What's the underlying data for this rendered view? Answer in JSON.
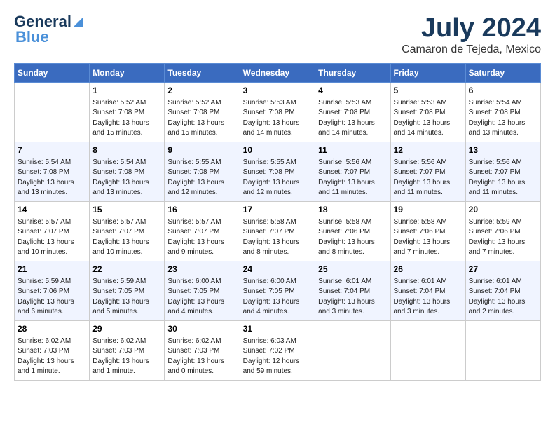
{
  "header": {
    "logo_line1": "General",
    "logo_line2": "Blue",
    "month_year": "July 2024",
    "location": "Camaron de Tejeda, Mexico"
  },
  "days_of_week": [
    "Sunday",
    "Monday",
    "Tuesday",
    "Wednesday",
    "Thursday",
    "Friday",
    "Saturday"
  ],
  "weeks": [
    [
      {
        "day": "",
        "sunrise": "",
        "sunset": "",
        "daylight": ""
      },
      {
        "day": "1",
        "sunrise": "Sunrise: 5:52 AM",
        "sunset": "Sunset: 7:08 PM",
        "daylight": "Daylight: 13 hours and 15 minutes."
      },
      {
        "day": "2",
        "sunrise": "Sunrise: 5:52 AM",
        "sunset": "Sunset: 7:08 PM",
        "daylight": "Daylight: 13 hours and 15 minutes."
      },
      {
        "day": "3",
        "sunrise": "Sunrise: 5:53 AM",
        "sunset": "Sunset: 7:08 PM",
        "daylight": "Daylight: 13 hours and 14 minutes."
      },
      {
        "day": "4",
        "sunrise": "Sunrise: 5:53 AM",
        "sunset": "Sunset: 7:08 PM",
        "daylight": "Daylight: 13 hours and 14 minutes."
      },
      {
        "day": "5",
        "sunrise": "Sunrise: 5:53 AM",
        "sunset": "Sunset: 7:08 PM",
        "daylight": "Daylight: 13 hours and 14 minutes."
      },
      {
        "day": "6",
        "sunrise": "Sunrise: 5:54 AM",
        "sunset": "Sunset: 7:08 PM",
        "daylight": "Daylight: 13 hours and 13 minutes."
      }
    ],
    [
      {
        "day": "7",
        "sunrise": "Sunrise: 5:54 AM",
        "sunset": "Sunset: 7:08 PM",
        "daylight": "Daylight: 13 hours and 13 minutes."
      },
      {
        "day": "8",
        "sunrise": "Sunrise: 5:54 AM",
        "sunset": "Sunset: 7:08 PM",
        "daylight": "Daylight: 13 hours and 13 minutes."
      },
      {
        "day": "9",
        "sunrise": "Sunrise: 5:55 AM",
        "sunset": "Sunset: 7:08 PM",
        "daylight": "Daylight: 13 hours and 12 minutes."
      },
      {
        "day": "10",
        "sunrise": "Sunrise: 5:55 AM",
        "sunset": "Sunset: 7:08 PM",
        "daylight": "Daylight: 13 hours and 12 minutes."
      },
      {
        "day": "11",
        "sunrise": "Sunrise: 5:56 AM",
        "sunset": "Sunset: 7:07 PM",
        "daylight": "Daylight: 13 hours and 11 minutes."
      },
      {
        "day": "12",
        "sunrise": "Sunrise: 5:56 AM",
        "sunset": "Sunset: 7:07 PM",
        "daylight": "Daylight: 13 hours and 11 minutes."
      },
      {
        "day": "13",
        "sunrise": "Sunrise: 5:56 AM",
        "sunset": "Sunset: 7:07 PM",
        "daylight": "Daylight: 13 hours and 11 minutes."
      }
    ],
    [
      {
        "day": "14",
        "sunrise": "Sunrise: 5:57 AM",
        "sunset": "Sunset: 7:07 PM",
        "daylight": "Daylight: 13 hours and 10 minutes."
      },
      {
        "day": "15",
        "sunrise": "Sunrise: 5:57 AM",
        "sunset": "Sunset: 7:07 PM",
        "daylight": "Daylight: 13 hours and 10 minutes."
      },
      {
        "day": "16",
        "sunrise": "Sunrise: 5:57 AM",
        "sunset": "Sunset: 7:07 PM",
        "daylight": "Daylight: 13 hours and 9 minutes."
      },
      {
        "day": "17",
        "sunrise": "Sunrise: 5:58 AM",
        "sunset": "Sunset: 7:07 PM",
        "daylight": "Daylight: 13 hours and 8 minutes."
      },
      {
        "day": "18",
        "sunrise": "Sunrise: 5:58 AM",
        "sunset": "Sunset: 7:06 PM",
        "daylight": "Daylight: 13 hours and 8 minutes."
      },
      {
        "day": "19",
        "sunrise": "Sunrise: 5:58 AM",
        "sunset": "Sunset: 7:06 PM",
        "daylight": "Daylight: 13 hours and 7 minutes."
      },
      {
        "day": "20",
        "sunrise": "Sunrise: 5:59 AM",
        "sunset": "Sunset: 7:06 PM",
        "daylight": "Daylight: 13 hours and 7 minutes."
      }
    ],
    [
      {
        "day": "21",
        "sunrise": "Sunrise: 5:59 AM",
        "sunset": "Sunset: 7:06 PM",
        "daylight": "Daylight: 13 hours and 6 minutes."
      },
      {
        "day": "22",
        "sunrise": "Sunrise: 5:59 AM",
        "sunset": "Sunset: 7:05 PM",
        "daylight": "Daylight: 13 hours and 5 minutes."
      },
      {
        "day": "23",
        "sunrise": "Sunrise: 6:00 AM",
        "sunset": "Sunset: 7:05 PM",
        "daylight": "Daylight: 13 hours and 4 minutes."
      },
      {
        "day": "24",
        "sunrise": "Sunrise: 6:00 AM",
        "sunset": "Sunset: 7:05 PM",
        "daylight": "Daylight: 13 hours and 4 minutes."
      },
      {
        "day": "25",
        "sunrise": "Sunrise: 6:01 AM",
        "sunset": "Sunset: 7:04 PM",
        "daylight": "Daylight: 13 hours and 3 minutes."
      },
      {
        "day": "26",
        "sunrise": "Sunrise: 6:01 AM",
        "sunset": "Sunset: 7:04 PM",
        "daylight": "Daylight: 13 hours and 3 minutes."
      },
      {
        "day": "27",
        "sunrise": "Sunrise: 6:01 AM",
        "sunset": "Sunset: 7:04 PM",
        "daylight": "Daylight: 13 hours and 2 minutes."
      }
    ],
    [
      {
        "day": "28",
        "sunrise": "Sunrise: 6:02 AM",
        "sunset": "Sunset: 7:03 PM",
        "daylight": "Daylight: 13 hours and 1 minute."
      },
      {
        "day": "29",
        "sunrise": "Sunrise: 6:02 AM",
        "sunset": "Sunset: 7:03 PM",
        "daylight": "Daylight: 13 hours and 1 minute."
      },
      {
        "day": "30",
        "sunrise": "Sunrise: 6:02 AM",
        "sunset": "Sunset: 7:03 PM",
        "daylight": "Daylight: 13 hours and 0 minutes."
      },
      {
        "day": "31",
        "sunrise": "Sunrise: 6:03 AM",
        "sunset": "Sunset: 7:02 PM",
        "daylight": "Daylight: 12 hours and 59 minutes."
      },
      {
        "day": "",
        "sunrise": "",
        "sunset": "",
        "daylight": ""
      },
      {
        "day": "",
        "sunrise": "",
        "sunset": "",
        "daylight": ""
      },
      {
        "day": "",
        "sunrise": "",
        "sunset": "",
        "daylight": ""
      }
    ]
  ]
}
